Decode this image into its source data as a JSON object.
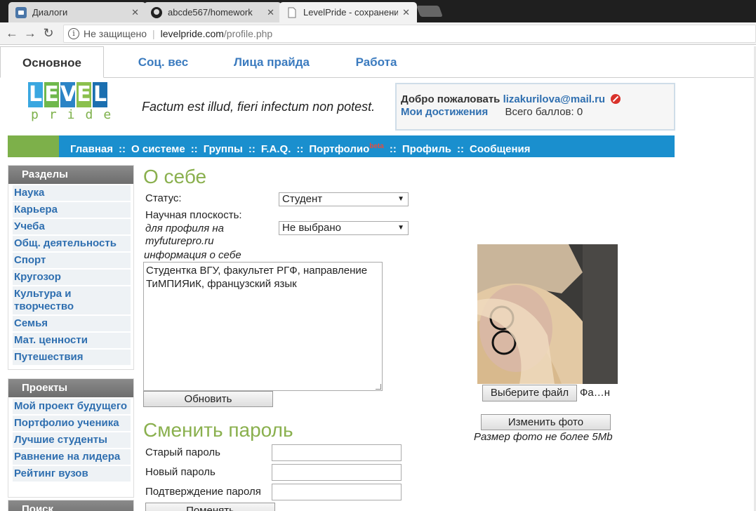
{
  "browser": {
    "tabs": [
      {
        "title": "Диалоги"
      },
      {
        "title": "abcde567/homework"
      },
      {
        "title": "LevelPride - сохранение"
      }
    ],
    "insecure_label": "Не защищено",
    "url_host": "levelpride.com",
    "url_path": "/profile.php"
  },
  "page_tabs": [
    "Основное",
    "Соц. вес",
    "Лица прайда",
    "Работа"
  ],
  "header": {
    "logo_letters": [
      "L",
      "E",
      "V",
      "E",
      "L"
    ],
    "logo_sub": "pride",
    "motto": "Factum est illud, fieri infectum non potest.",
    "welcome_label": "Добро пожаловать",
    "email": "lizakurilova@mail.ru",
    "achievements": "Мои достижения",
    "points": "Всего баллов: 0"
  },
  "mainnav": {
    "items": [
      "Главная",
      "О системе",
      "Группы",
      "F.A.Q.",
      "Портфолио",
      "Профиль",
      "Сообщения"
    ],
    "separator": "::",
    "beta": "beta"
  },
  "sidebar": {
    "sections_title": "Разделы",
    "sections": [
      "Наука",
      "Карьера",
      "Учеба",
      "Общ. деятельность",
      "Спорт",
      "Кругозор",
      "Культура и творчество",
      "Семья",
      "Мат. ценности",
      "Путешествия"
    ],
    "projects_title": "Проекты",
    "projects": [
      "Мой проект будущего",
      "Портфолио ученика",
      "Лучшие студенты",
      "Равнение на лидера",
      "Рейтинг вузов"
    ],
    "search_title": "Поиск"
  },
  "about": {
    "title": "О себе",
    "status_label": "Статус:",
    "status_value": "Студент",
    "science_label": "Научная плоскость:",
    "science_hint_1": "для профиля на",
    "science_hint_2": "myfuturepro.ru",
    "science_value": "Не выбрано",
    "info_label": "информация о себе",
    "info_text": "Студентка ВГУ, факультет РГФ, направление ТиМПИЯиК, французский язык",
    "update_button": "Обновить"
  },
  "photo": {
    "choose_button": "Выберите файл",
    "filename": "Фа…н",
    "change_button": "Изменить фото",
    "note": "Размер фото не более 5Mb"
  },
  "password": {
    "title": "Сменить пароль",
    "old_label": "Старый пароль",
    "new_label": "Новый пароль",
    "confirm_label": "Подтверждение пароля",
    "change_button": "Поменять"
  },
  "colors": {
    "accent_green": "#8ab04e",
    "nav_blue": "#1a8fce",
    "link_blue": "#2f6fb0"
  }
}
